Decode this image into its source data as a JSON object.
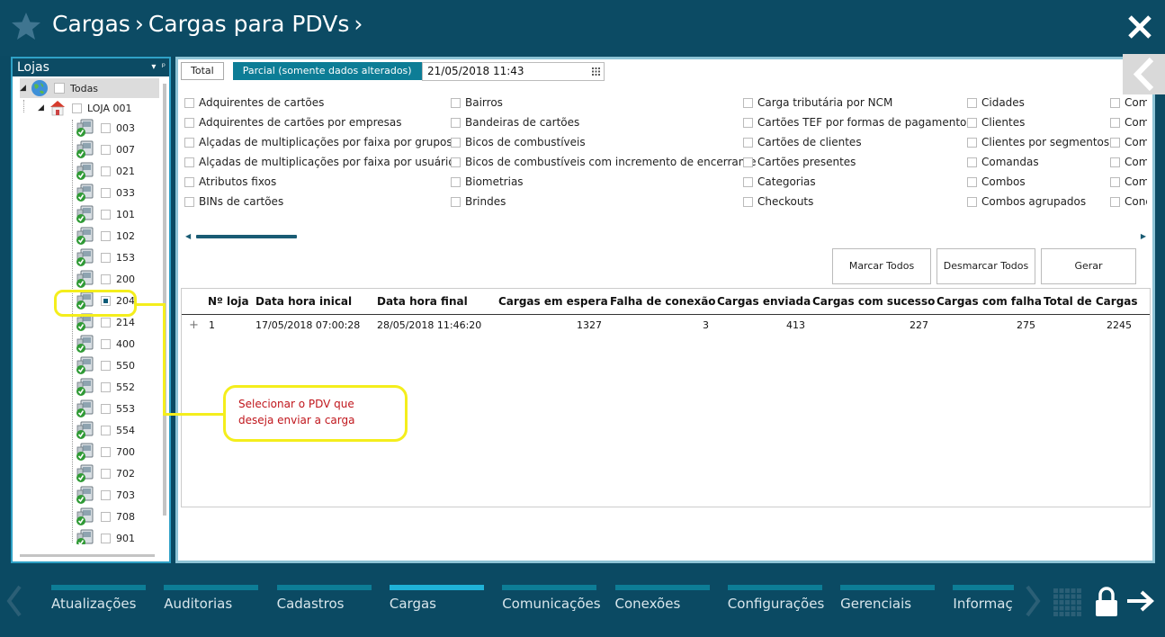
{
  "header": {
    "breadcrumb": [
      "Cargas",
      "Cargas para PDVs"
    ]
  },
  "lojas_panel": {
    "title": "Lojas",
    "root_label": "Todas",
    "store_label": "LOJA 001",
    "pdvs": [
      "003",
      "007",
      "021",
      "033",
      "101",
      "102",
      "153",
      "200",
      "204",
      "214",
      "400",
      "550",
      "552",
      "553",
      "554",
      "700",
      "702",
      "703",
      "708",
      "901"
    ],
    "selected_pdv": "204"
  },
  "tabs": [
    {
      "label": "Total"
    },
    {
      "label": "Parcial (somente dados alterados)"
    }
  ],
  "date_value": "21/05/2018 11:43",
  "options": {
    "col1": [
      "Adquirentes de cartões",
      "Adquirentes de cartões por empresas",
      "Alçadas de multiplicações por faixa por grupos",
      "Alçadas de multiplicações por faixa por usuários",
      "Atributos fixos",
      "BINs de cartões"
    ],
    "col2": [
      "Bairros",
      "Bandeiras de cartões",
      "Bicos de combustíveis",
      "Bicos de combustíveis com incremento de encerrante",
      "Biometrias",
      "Brindes"
    ],
    "col3": [
      "Carga tributária por NCM",
      "Cartões TEF por formas de pagamentos",
      "Cartões de clientes",
      "Cartões presentes",
      "Categorias",
      "Checkouts"
    ],
    "col4": [
      "Cidades",
      "Clientes",
      "Clientes por segmentos",
      "Comandas",
      "Combos",
      "Combos agrupados"
    ],
    "col5": [
      "Com",
      "Com",
      "Com",
      "Com",
      "Com",
      "Cond"
    ]
  },
  "buttons": {
    "marcar": "Marcar Todos",
    "desmarcar": "Desmarcar Todos",
    "gerar": "Gerar"
  },
  "table": {
    "headers": [
      "Nº loja",
      "Data hora inical",
      "Data hora final",
      "Cargas em espera",
      "Falha de conexão",
      "Cargas enviada",
      "Cargas com sucesso",
      "Cargas com falha",
      "Total de Cargas"
    ],
    "rows": [
      {
        "expand": "+",
        "loja": "1",
        "inicio": "17/05/2018 07:00:28",
        "fim": "28/05/2018 11:46:20",
        "espera": "1327",
        "falha_conexao": "3",
        "enviada": "413",
        "sucesso": "227",
        "falha": "275",
        "total": "2245"
      }
    ]
  },
  "callout": {
    "text": "Selecionar o PDV que deseja enviar a carga"
  },
  "nav": [
    "Atualizações",
    "Auditorias",
    "Cadastros",
    "Cargas",
    "Comunicações",
    "Conexões",
    "Configurações",
    "Gerenciais",
    "Informaç"
  ],
  "nav_active": "Cargas",
  "colors": {
    "header_bg": "#0c4b64",
    "accent": "#0d7d96",
    "active_bar": "#1fb2d8",
    "callout": "#f4ee1c",
    "callout_text": "#c0161c"
  }
}
